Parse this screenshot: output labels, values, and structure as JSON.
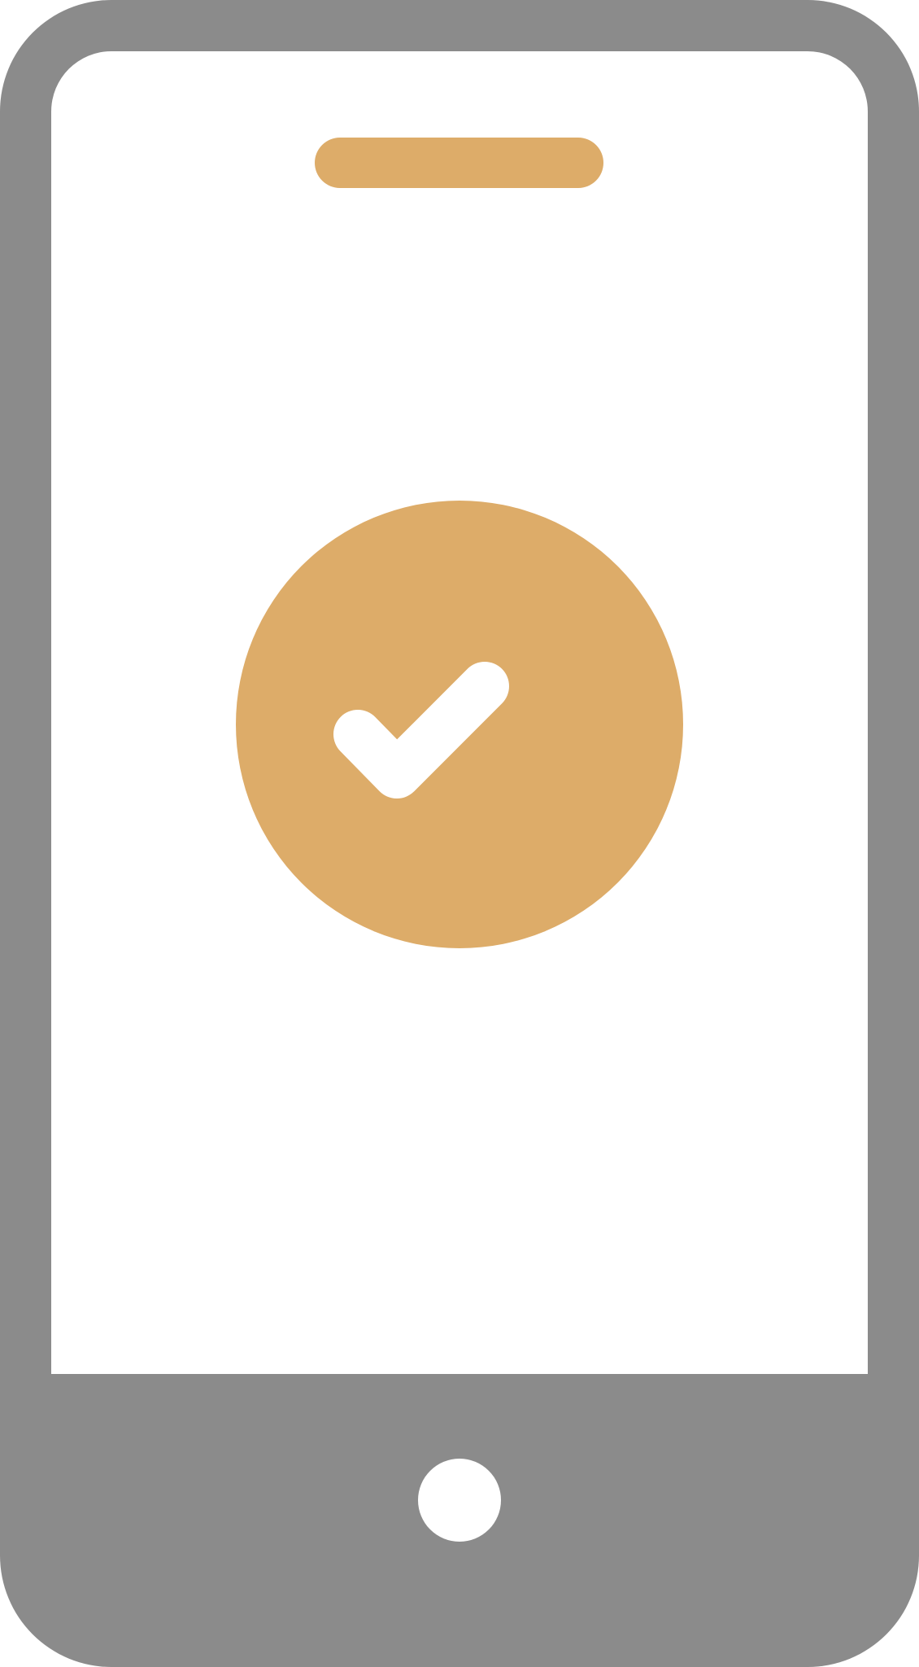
{
  "icon": {
    "name": "smartphone-check-icon",
    "colors": {
      "body": "#8b8b8b",
      "screen": "#ffffff",
      "accent": "#ddac69",
      "home_button": "#ffffff",
      "check": "#ffffff"
    }
  }
}
